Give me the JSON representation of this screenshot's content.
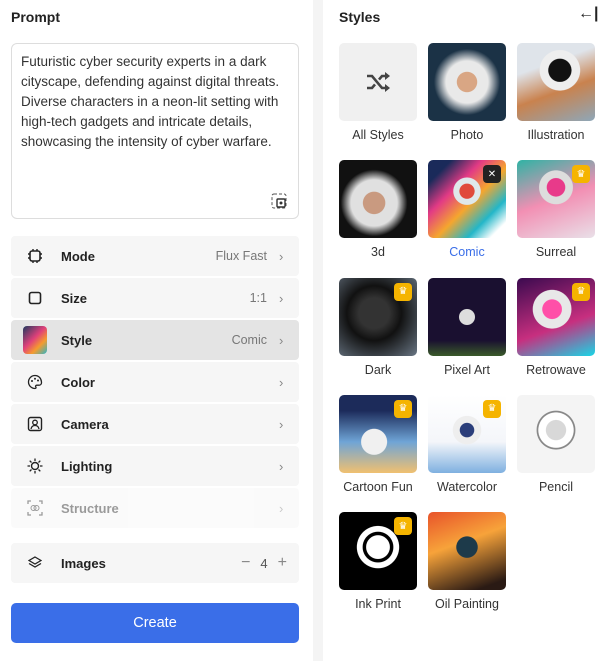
{
  "prompt": {
    "title": "Prompt",
    "text": "Futuristic cyber security experts in a dark cityscape, defending against digital threats. Diverse characters in a neon-lit setting with high-tech gadgets and intricate details, showcasing the intensity of cyber warfare."
  },
  "settings": [
    {
      "label": "Mode",
      "value": "Flux Fast",
      "icon": "chip-icon"
    },
    {
      "label": "Size",
      "value": "1:1",
      "icon": "square-icon"
    },
    {
      "label": "Style",
      "value": "Comic",
      "icon": "style-thumbnail"
    },
    {
      "label": "Color",
      "value": "",
      "icon": "palette-icon"
    },
    {
      "label": "Camera",
      "value": "",
      "icon": "camera-icon"
    },
    {
      "label": "Lighting",
      "value": "",
      "icon": "sun-icon"
    },
    {
      "label": "Structure",
      "value": "",
      "icon": "structure-icon",
      "disabled": true
    }
  ],
  "images": {
    "label": "Images",
    "count": "4",
    "minus": "−",
    "plus": "+"
  },
  "create_label": "Create",
  "styles": {
    "title": "Styles",
    "collapse_icon": "←|",
    "items": [
      {
        "label": "All Styles",
        "icon": "shuffle-icon"
      },
      {
        "label": "Photo"
      },
      {
        "label": "Illustration"
      },
      {
        "label": "3d"
      },
      {
        "label": "Comic",
        "selected": true,
        "badge": "close"
      },
      {
        "label": "Surreal",
        "badge": "crown"
      },
      {
        "label": "Dark",
        "badge": "crown"
      },
      {
        "label": "Pixel Art"
      },
      {
        "label": "Retrowave",
        "badge": "crown"
      },
      {
        "label": "Cartoon Fun",
        "badge": "crown"
      },
      {
        "label": "Watercolor",
        "badge": "crown"
      },
      {
        "label": "Pencil"
      },
      {
        "label": "Ink Print",
        "badge": "crown"
      },
      {
        "label": "Oil Painting"
      }
    ]
  },
  "colors": {
    "accent": "#3a6ee8",
    "crown": "#f5b400"
  }
}
